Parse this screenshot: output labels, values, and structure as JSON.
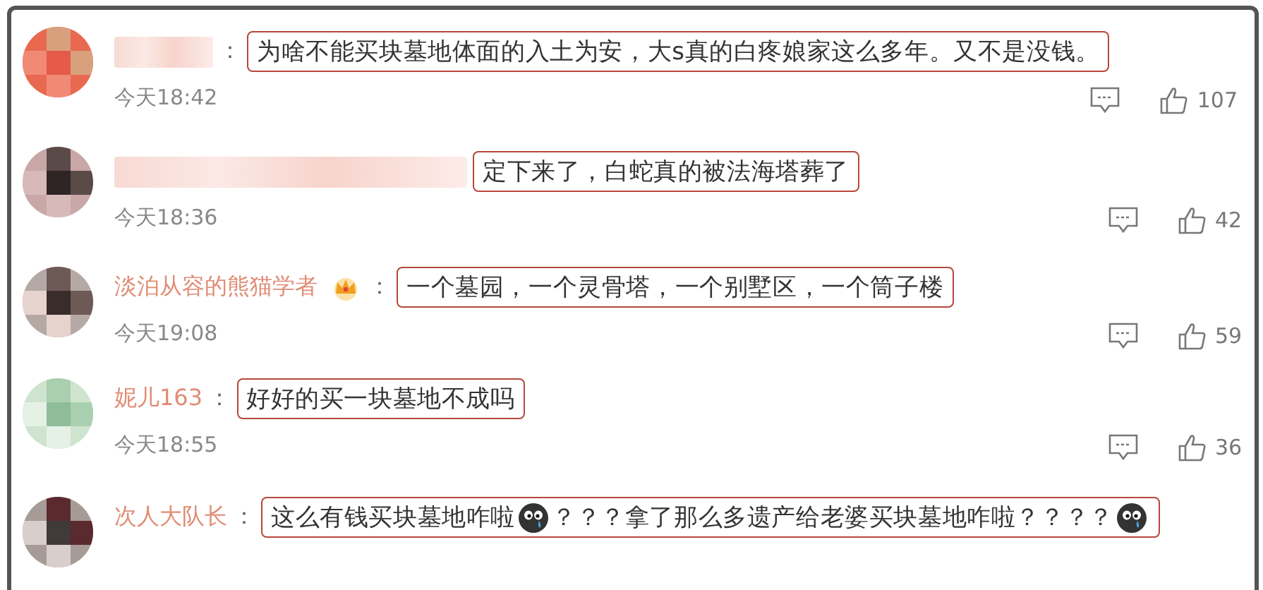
{
  "comments": [
    {
      "name_blurred": true,
      "colon": "：",
      "parts": [
        {
          "kind": "text",
          "text": "为啥不能买块墓地体面的入土为安，大s真的白疼娘家这么多年。又不是没钱。"
        }
      ],
      "time": "今天18:42",
      "likes": "107"
    },
    {
      "name_blurred": true,
      "parts": [
        {
          "kind": "text",
          "text": "定下来了，白蛇真的被法海塔葬了"
        }
      ],
      "time": "今天18:36",
      "likes": "42"
    },
    {
      "name": "淡泊从容的熊猫学者",
      "badge": {
        "kind": "crown"
      },
      "colon": "：",
      "parts": [
        {
          "kind": "text",
          "text": "一个墓园，一个灵骨塔，一个别墅区，一个筒子楼"
        }
      ],
      "time": "今天19:08",
      "likes": "59"
    },
    {
      "name": "妮儿163",
      "colon": "：",
      "parts": [
        {
          "kind": "text",
          "text": "好好的买一块墓地不成吗"
        }
      ],
      "time": "今天18:55",
      "likes": "36"
    },
    {
      "name": "次人大队长",
      "colon": "：",
      "parts": [
        {
          "kind": "text",
          "text": "这么有钱买块墓地咋啦"
        },
        {
          "kind": "emoji"
        },
        {
          "kind": "text",
          "text": "？？？拿了那么多遗产给老婆买块墓地咋啦？？？？"
        },
        {
          "kind": "emoji"
        }
      ]
    }
  ]
}
